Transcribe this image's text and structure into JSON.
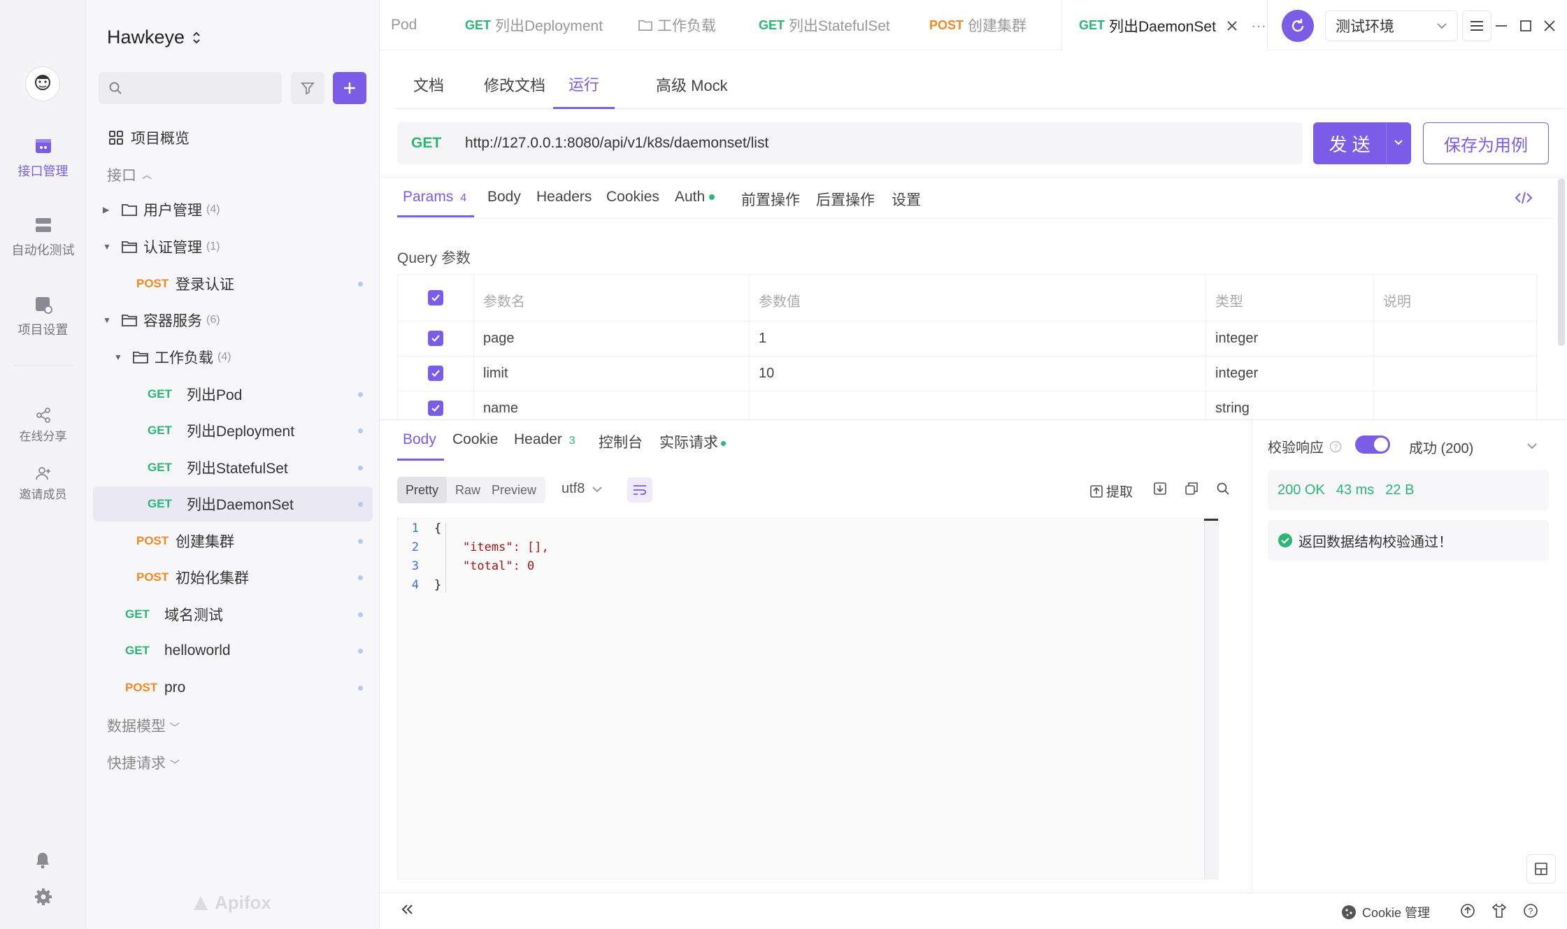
{
  "workspace": {
    "name": "Hawkeye"
  },
  "rail": {
    "items": [
      {
        "label": "接口管理",
        "icon": "api-icon"
      },
      {
        "label": "自动化测试",
        "icon": "automation-icon"
      },
      {
        "label": "项目设置",
        "icon": "settings-icon"
      },
      {
        "label": "在线分享",
        "icon": "share-icon"
      },
      {
        "label": "邀请成员",
        "icon": "invite-icon"
      }
    ]
  },
  "sidebar": {
    "overview": "项目概览",
    "section_api": "接口",
    "section_models": "数据模型",
    "section_quick": "快捷请求",
    "tree": [
      {
        "label": "用户管理",
        "count": "(4)"
      },
      {
        "label": "认证管理",
        "count": "(1)"
      },
      {
        "method": "POST",
        "label": "登录认证"
      },
      {
        "label": "容器服务",
        "count": "(6)"
      },
      {
        "label": "工作负载",
        "count": "(4)"
      },
      {
        "method": "GET",
        "label": "列出Pod"
      },
      {
        "method": "GET",
        "label": "列出Deployment"
      },
      {
        "method": "GET",
        "label": "列出StatefulSet"
      },
      {
        "method": "GET",
        "label": "列出DaemonSet"
      },
      {
        "method": "POST",
        "label": "创建集群"
      },
      {
        "method": "POST",
        "label": "初始化集群"
      },
      {
        "method": "GET",
        "label": "域名测试"
      },
      {
        "method": "GET",
        "label": "helloworld"
      },
      {
        "method": "POST",
        "label": "pro"
      }
    ],
    "brand": "Apifox"
  },
  "tabs": [
    {
      "method": "",
      "label": "Pod"
    },
    {
      "method": "GET",
      "label": "列出Deployment"
    },
    {
      "method": "",
      "label": "工作负载"
    },
    {
      "method": "GET",
      "label": "列出StatefulSet"
    },
    {
      "method": "POST",
      "label": "创建集群"
    },
    {
      "method": "GET",
      "label": "列出DaemonSet"
    }
  ],
  "env": {
    "selected": "测试环境"
  },
  "subtabs": [
    "文档",
    "修改文档",
    "运行",
    "高级 Mock"
  ],
  "request": {
    "method": "GET",
    "url": "http://127.0.0.1:8080/api/v1/k8s/daemonset/list",
    "send_label": "发 送",
    "save_label": "保存为用例"
  },
  "param_tabs": [
    {
      "label": "Params",
      "count": "4"
    },
    {
      "label": "Body"
    },
    {
      "label": "Headers"
    },
    {
      "label": "Cookies"
    },
    {
      "label": "Auth"
    },
    {
      "label": "前置操作"
    },
    {
      "label": "后置操作"
    },
    {
      "label": "设置"
    }
  ],
  "query": {
    "title": "Query 参数",
    "headers": [
      "参数名",
      "参数值",
      "类型",
      "说明"
    ],
    "rows": [
      {
        "name": "page",
        "value": "1",
        "type": "integer",
        "desc": ""
      },
      {
        "name": "limit",
        "value": "10",
        "type": "integer",
        "desc": ""
      },
      {
        "name": "name",
        "value": "",
        "type": "string",
        "desc": ""
      }
    ]
  },
  "response_tabs": [
    {
      "label": "Body"
    },
    {
      "label": "Cookie"
    },
    {
      "label": "Header",
      "count": "3"
    },
    {
      "label": "控制台"
    },
    {
      "label": "实际请求"
    }
  ],
  "view_modes": [
    "Pretty",
    "Raw",
    "Preview"
  ],
  "encoding": "utf8",
  "extract_label": "提取",
  "code_lines": [
    {
      "n": "1",
      "text": "{"
    },
    {
      "n": "2",
      "text": "    \"items\": [],"
    },
    {
      "n": "3",
      "text": "    \"total\": 0"
    },
    {
      "n": "4",
      "text": "}"
    }
  ],
  "validation": {
    "label": "校验响应",
    "result": "成功 (200)",
    "status": "200 OK",
    "time": "43 ms",
    "size": "22 B",
    "message": "返回数据结构校验通过！"
  },
  "footer": {
    "cookie_label": "Cookie 管理"
  },
  "colors": {
    "accent": "#7b5ce6",
    "get": "#2bb673",
    "post": "#f08a24"
  }
}
